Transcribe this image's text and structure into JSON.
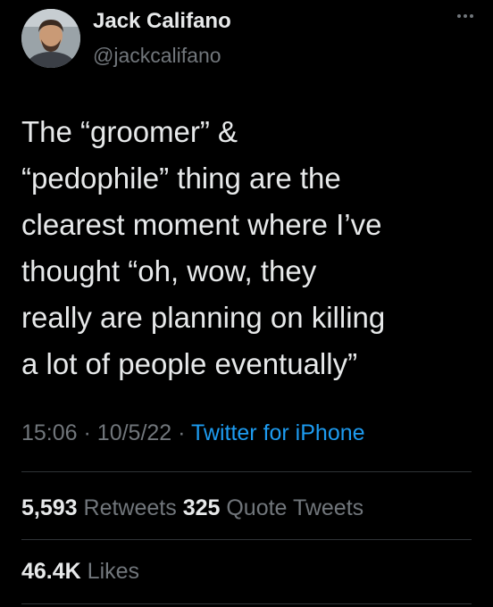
{
  "author": {
    "name": "Jack Califano",
    "handle": "@jackcalifano",
    "avatar_icon": "profile-photo"
  },
  "tweet": {
    "lines": [
      "The “groomer” &",
      "“pedophile” thing are the",
      "clearest moment where I’ve",
      "thought “oh, wow, they",
      "really are planning on killing",
      "a lot of people eventually”"
    ],
    "time": "15:06",
    "date": "10/5/22",
    "separator": "·",
    "source": "Twitter for iPhone"
  },
  "stats": {
    "retweets_count": "5,593",
    "retweets_label": "Retweets",
    "quotes_count": "325",
    "quotes_label": "Quote Tweets",
    "likes_count": "46.4K",
    "likes_label": "Likes"
  },
  "colors": {
    "background": "#000000",
    "text": "#e7e9ea",
    "secondary": "#71767b",
    "link": "#1d9bf0",
    "divider": "#2f3336"
  }
}
